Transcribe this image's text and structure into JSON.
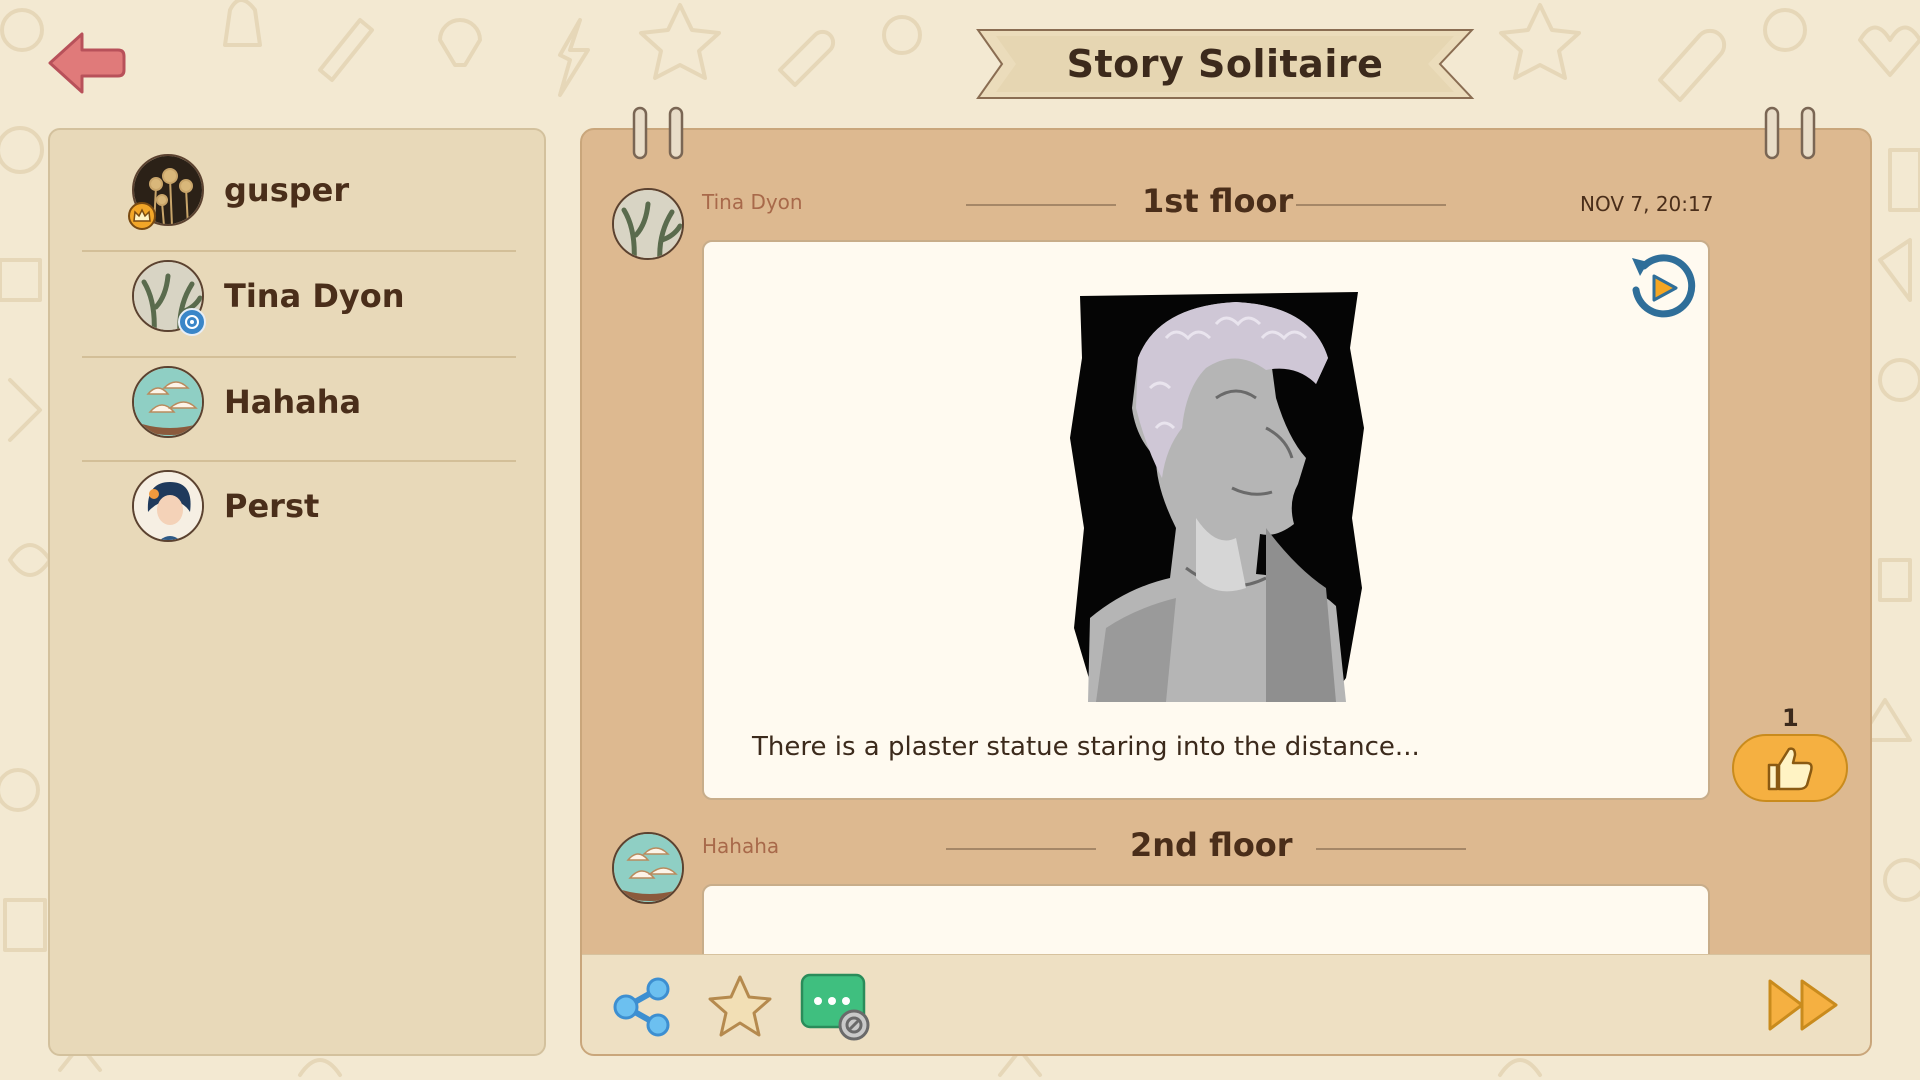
{
  "header": {
    "title": "Story Solitaire"
  },
  "sidebar": {
    "players": [
      {
        "name": "gusper",
        "badge": "crown-icon"
      },
      {
        "name": "Tina Dyon",
        "badge": "target-icon"
      },
      {
        "name": "Hahaha",
        "badge": ""
      },
      {
        "name": "Perst",
        "badge": ""
      }
    ]
  },
  "story": {
    "floors": [
      {
        "author": "Tina Dyon",
        "title": "1st floor",
        "date": "NOV 7, 20:17",
        "caption": "There is a plaster statue staring into the distance...",
        "likes": "1"
      },
      {
        "author": "Hahaha",
        "title": "2nd floor"
      }
    ]
  },
  "toolbar": {
    "icons": [
      "share-icon",
      "star-icon",
      "chat-disabled-icon",
      "fast-forward-icon"
    ]
  },
  "colors": {
    "background": "#f3e9d2",
    "sidebar": "#e8d9b9",
    "panel": "#ddb990",
    "card": "#fffaf0",
    "like": "#f5b041",
    "back": "#e07a7a",
    "share": "#5aa9e6",
    "chat": "#3fbf7f"
  }
}
